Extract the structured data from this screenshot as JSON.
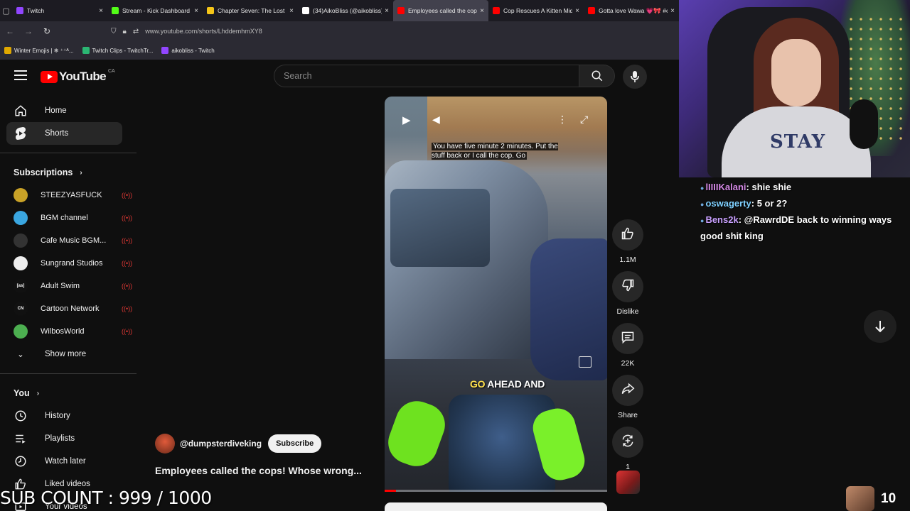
{
  "browser": {
    "tabs": [
      {
        "title": "Twitch",
        "color": "#9146ff",
        "active": false
      },
      {
        "title": "Stream - Kick Dashboard",
        "color": "#53fc18",
        "active": false
      },
      {
        "title": "Chapter Seven: The Lost Si",
        "color": "#f5c518",
        "active": false
      },
      {
        "title": "(34)AikoBliss (@aikobliss) |",
        "color": "#ffffff",
        "active": false
      },
      {
        "title": "Employees called the cops!",
        "color": "#ff0000",
        "active": true
      },
      {
        "title": "Cop Rescues A Kitten Mid-",
        "color": "#ff0000",
        "active": false
      },
      {
        "title": "Gotta love Wawa 💗🎀 #c",
        "color": "#ff0000",
        "active": false
      }
    ],
    "url": "www.youtube.com/shorts/LhddemhmXY8",
    "bookmarks": [
      {
        "label": "Winter Emojis | ❄ ⁺⁺ᴬ...",
        "color": "#e0a800"
      },
      {
        "label": "Twitch Clips - TwitchTr...",
        "color": "#2bb673"
      },
      {
        "label": "aikobliss - Twitch",
        "color": "#9146ff"
      }
    ]
  },
  "youtube": {
    "logo_text": "YouTube",
    "country": "CA",
    "search_placeholder": "Search",
    "nav": [
      {
        "label": "Home",
        "icon": "home-icon"
      },
      {
        "label": "Shorts",
        "icon": "shorts-icon",
        "active": true
      }
    ],
    "subscriptions_heading": "Subscriptions",
    "subscriptions": [
      {
        "name": "STEEZYASFUCK",
        "color": "#c9a227"
      },
      {
        "name": "BGM channel",
        "color": "#3aa6e0"
      },
      {
        "name": "Cafe Music BGM...",
        "color": "#333333"
      },
      {
        "name": "Sungrand Studios",
        "color": "#eeeeee"
      },
      {
        "name": "Adult Swim",
        "color": "#111111",
        "mark": "[as]"
      },
      {
        "name": "Cartoon Network",
        "color": "#111111",
        "mark": "CN"
      },
      {
        "name": "WilbosWorld",
        "color": "#4caf50"
      }
    ],
    "show_more": "Show more",
    "you_heading": "You",
    "you_items": [
      {
        "label": "History",
        "icon": "history-icon"
      },
      {
        "label": "Playlists",
        "icon": "playlists-icon"
      },
      {
        "label": "Watch later",
        "icon": "watch-later-icon"
      },
      {
        "label": "Liked videos",
        "icon": "liked-videos-icon"
      },
      {
        "label": "Your videos",
        "icon": "your-videos-icon"
      }
    ],
    "short": {
      "subtitle": "You have five minute 2 minutes. Put the stuff back or I call the cop. Go",
      "caption_highlight": "GO",
      "caption_rest": "AHEAD AND",
      "channel": "@dumpsterdiveking",
      "subscribe": "Subscribe",
      "title": "Employees called the cops! Whose wrong...",
      "progress": 0.05
    },
    "actions": [
      {
        "label": "1.1M",
        "icon": "like-icon"
      },
      {
        "label": "Dislike",
        "icon": "dislike-icon"
      },
      {
        "label": "22K",
        "icon": "comment-icon"
      },
      {
        "label": "Share",
        "icon": "share-icon"
      },
      {
        "label": "1",
        "icon": "remix-icon"
      }
    ]
  },
  "stream_overlay": {
    "chat": [
      {
        "user": "lIIIIKalani",
        "message": "shie shie"
      },
      {
        "user": "oswagerty",
        "message": "5 or 2?"
      },
      {
        "user": "Bens2k",
        "message": "@RawrdDE back to winning ways good shit king"
      }
    ],
    "sub_count": "SUB COUNT : 999 / 1000",
    "viewer_count": "10",
    "webcam_shirt_text": "STAY"
  }
}
